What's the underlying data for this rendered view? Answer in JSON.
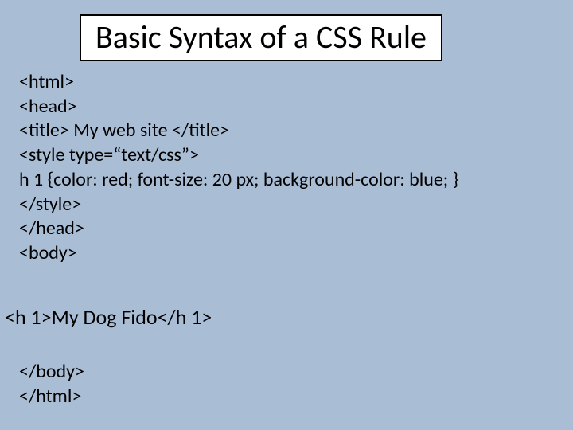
{
  "title": "Basic Syntax of a CSS Rule",
  "code": {
    "l1": "<html>",
    "l2": "<head>",
    "l3": "<title> My web site </title>",
    "l4": "<style type=“text/css”>",
    "l5": " h 1 {color: red; font-size: 20 px; background-color: blue; }",
    "l6": " </style>",
    "l7": "</head>",
    "l8": "<body>"
  },
  "heading": "<h 1>My Dog Fido</h 1>",
  "closing": {
    "l1": "</body>",
    "l2": "</html>"
  }
}
